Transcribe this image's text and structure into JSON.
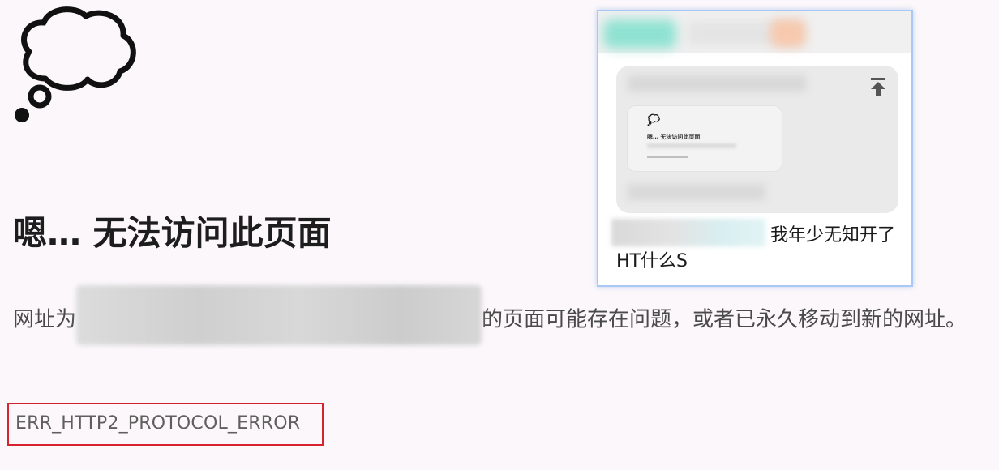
{
  "error_page": {
    "title": "嗯… 无法访问此页面",
    "description_prefix": "网址为",
    "description_suffix": "的页面可能存在问题，或者已永久移动到新的网址。",
    "error_code": "ERR_HTTP2_PROTOCOL_ERROR",
    "highlight_color": "#d6232d",
    "icon": "thought-cloud-icon"
  },
  "share_card": {
    "border_color": "#a9c8f5",
    "thumbnail_title": "嗯… 无法访问此页面",
    "thumbnail_icon": "thought-cloud-icon",
    "action_icon": "upload-to-top-icon",
    "caption": "我年少无知开了HT什么S"
  }
}
